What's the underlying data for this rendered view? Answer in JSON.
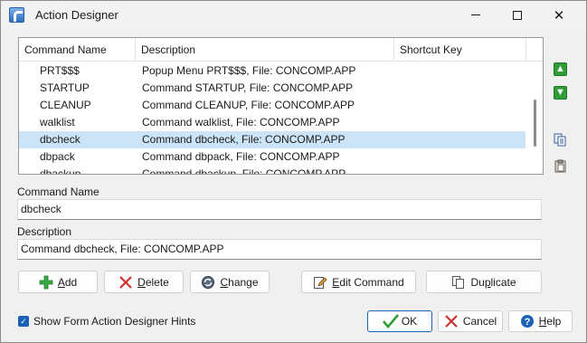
{
  "window": {
    "title": "Action Designer"
  },
  "controls": {
    "minimize": "—",
    "maximize": "☐",
    "close": "✕"
  },
  "list": {
    "columns": [
      "Command Name",
      "Description",
      "Shortcut Key"
    ],
    "rows": [
      {
        "name": "PRT$$$",
        "description": "Popup Menu PRT$$$, File: CONCOMP.APP",
        "shortcut": ""
      },
      {
        "name": "STARTUP",
        "description": "Command STARTUP, File: CONCOMP.APP",
        "shortcut": ""
      },
      {
        "name": "CLEANUP",
        "description": "Command CLEANUP, File: CONCOMP.APP",
        "shortcut": ""
      },
      {
        "name": "walklist",
        "description": "Command walklist, File: CONCOMP.APP",
        "shortcut": ""
      },
      {
        "name": "dbcheck",
        "description": "Command dbcheck, File: CONCOMP.APP",
        "shortcut": ""
      },
      {
        "name": "dbpack",
        "description": "Command dbpack, File: CONCOMP.APP",
        "shortcut": ""
      },
      {
        "name": "dbackup",
        "description": "Command dbackup, File: CONCOMP.APP",
        "shortcut": ""
      }
    ],
    "selected_index": 4
  },
  "side_icons": [
    "move-up-icon",
    "move-down-icon",
    "copy-icon",
    "paste-icon"
  ],
  "fields": {
    "command_name_label": "Command Name",
    "command_name_value": "dbcheck",
    "description_label": "Description",
    "description_value": "Command dbcheck, File: CONCOMP.APP"
  },
  "buttons": {
    "add": {
      "hot": "A",
      "rest": "dd"
    },
    "delete": {
      "hot": "D",
      "rest": "elete"
    },
    "change": {
      "hot": "C",
      "rest": "hange"
    },
    "edit_command": {
      "hot": "E",
      "rest": "dit Command"
    },
    "duplicate": {
      "pre": "Du",
      "hot": "p",
      "rest": "licate"
    },
    "ok": "OK",
    "cancel": "Cancel",
    "help": {
      "hot": "H",
      "rest": "elp"
    }
  },
  "hints": {
    "label": "Show Form Action Designer Hints",
    "checked": true
  },
  "colors": {
    "selection": "#cce4f7",
    "accent": "#1a62b8",
    "ok_green": "#2f9e38",
    "cancel_red": "#d23030"
  }
}
